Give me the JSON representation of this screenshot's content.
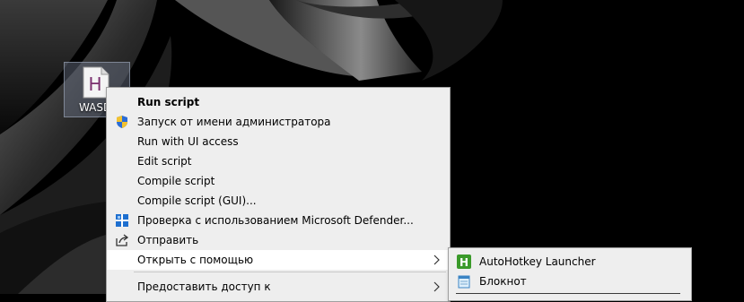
{
  "desktop": {
    "icon": {
      "label": "WASD.",
      "glyph_letter": "H",
      "icon": "ahk-file-icon"
    }
  },
  "context_menu": {
    "items": [
      {
        "label": "Run script",
        "bold": true
      },
      {
        "label": "Запуск от имени администратора",
        "icon": "uac-shield-icon"
      },
      {
        "label": "Run with UI access"
      },
      {
        "label": "Edit script"
      },
      {
        "label": "Compile script"
      },
      {
        "label": "Compile script (GUI)..."
      },
      {
        "label": "Проверка с использованием Microsoft Defender...",
        "icon": "defender-icon"
      },
      {
        "label": "Отправить",
        "icon": "share-icon"
      },
      {
        "label": "Открыть с помощью",
        "submenu": true,
        "highlighted": true
      },
      {
        "label": "Предоставить доступ к",
        "submenu": true
      }
    ]
  },
  "open_with_submenu": {
    "items": [
      {
        "label": "AutoHotkey Launcher",
        "icon": "autohotkey-icon",
        "icon_letter": "H",
        "color": "#3a9a2a"
      },
      {
        "label": "Блокнот",
        "icon": "notepad-icon"
      }
    ]
  },
  "colors": {
    "menu_background": "#eeeeee",
    "menu_highlight": "#ffffff",
    "desktop_background": "#000000",
    "ahk_purple": "#7a2f6e"
  }
}
